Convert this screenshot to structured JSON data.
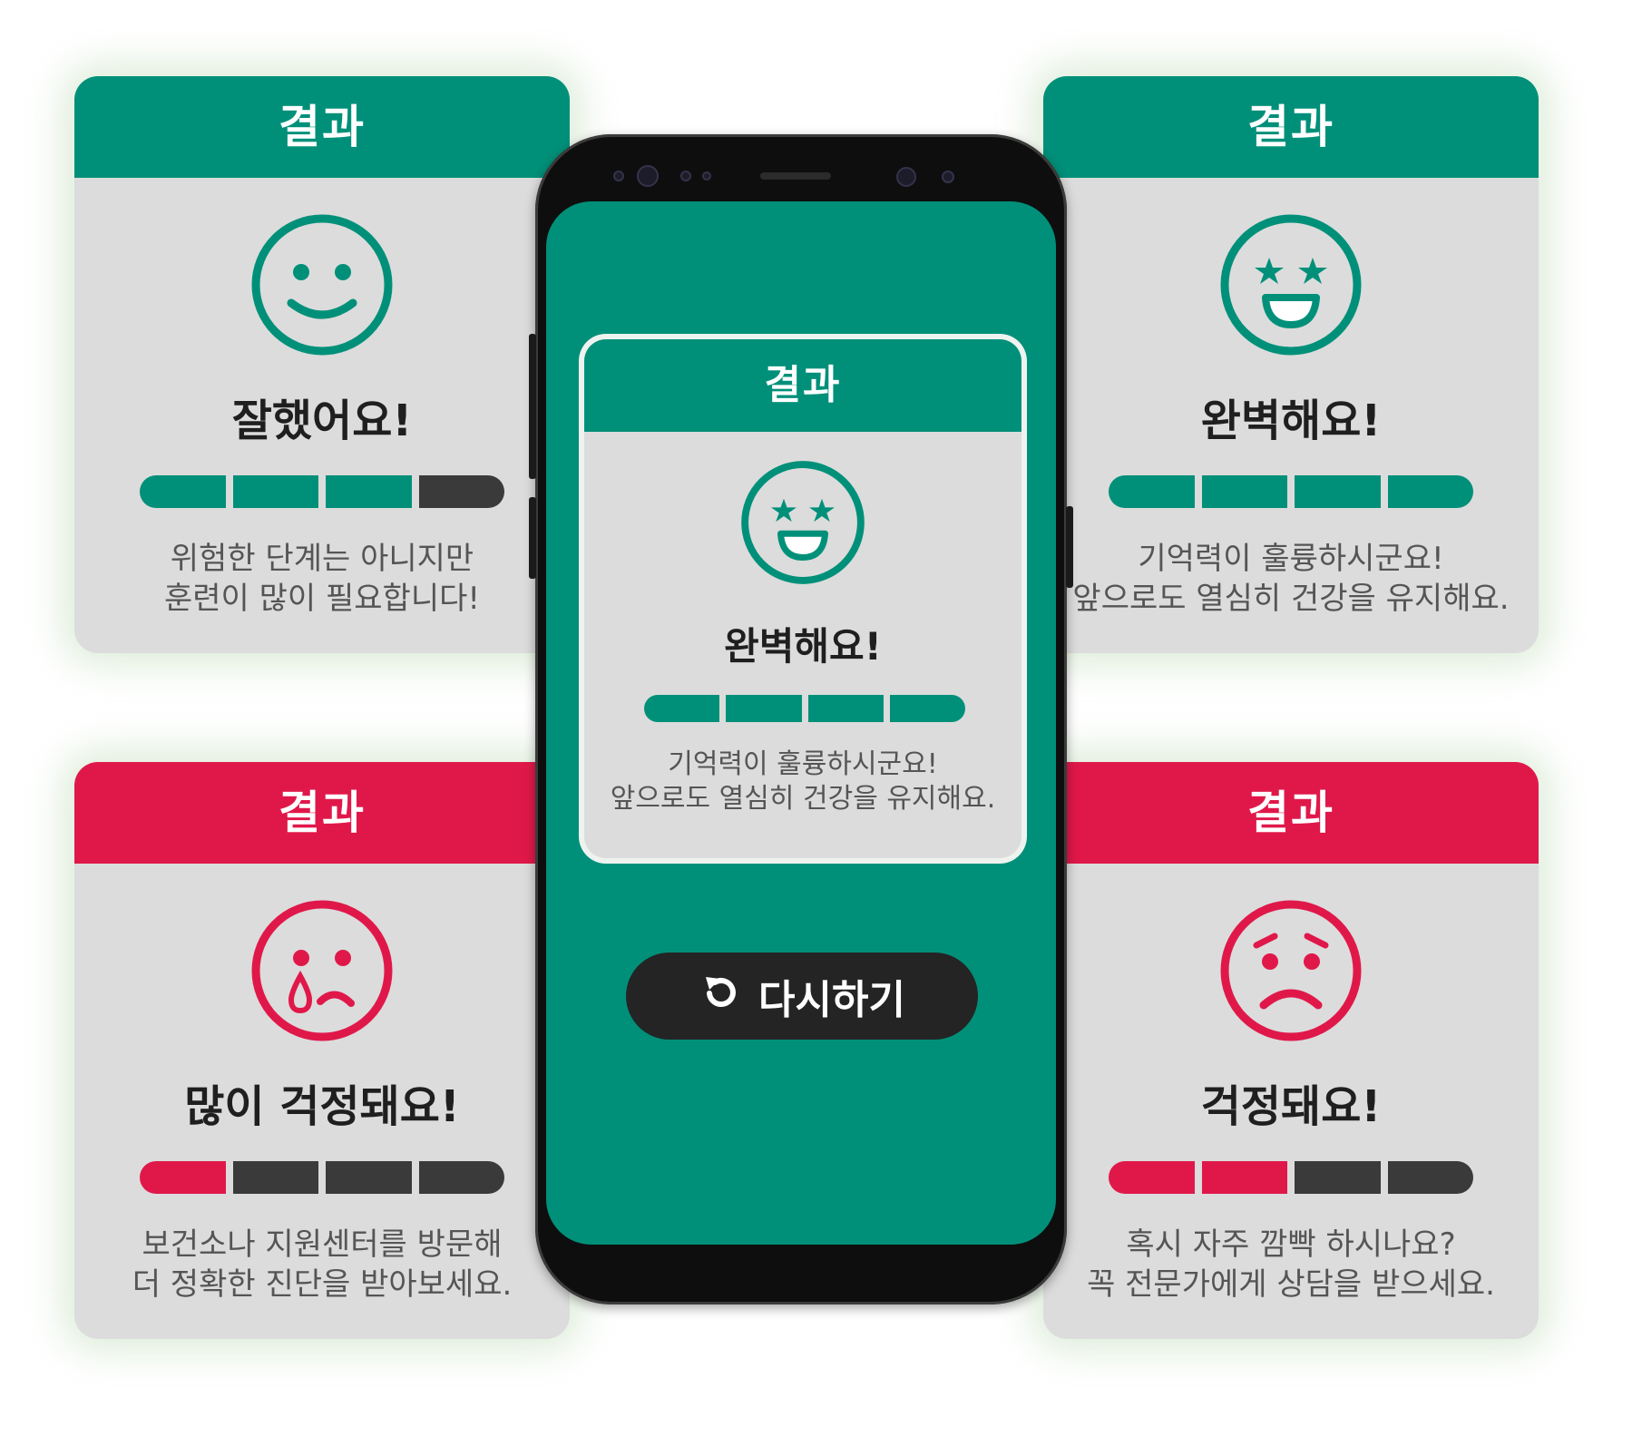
{
  "colors": {
    "green": "#009079",
    "red": "#e0184a",
    "dark": "#3a3a3a",
    "card_bg": "#dcdcdc",
    "button_bg": "#242424"
  },
  "cards": {
    "top_left": {
      "header": "결과",
      "face_icon": "smile-face-icon",
      "title": "잘했어요!",
      "level": 3,
      "total": 4,
      "message_line1": "위험한 단계는 아니지만",
      "message_line2": "훈련이 많이 필요합니다!"
    },
    "top_right": {
      "header": "결과",
      "face_icon": "star-eyes-face-icon",
      "title": "완벽해요!",
      "level": 4,
      "total": 4,
      "message_line1": "기억력이 훌륭하시군요!",
      "message_line2": "앞으로도 열심히 건강을 유지해요."
    },
    "bottom_left": {
      "header": "결과",
      "face_icon": "crying-face-icon",
      "title": "많이 걱정돼요!",
      "level": 1,
      "total": 4,
      "message_line1": "보건소나 지원센터를 방문해",
      "message_line2": "더 정확한 진단을 받아보세요."
    },
    "bottom_right": {
      "header": "결과",
      "face_icon": "worried-face-icon",
      "title": "걱정돼요!",
      "level": 2,
      "total": 4,
      "message_line1": "혹시 자주 깜빡 하시나요?",
      "message_line2": "꼭 전문가에게 상담을 받으세요."
    }
  },
  "phone": {
    "result": {
      "header": "결과",
      "face_icon": "star-eyes-face-icon",
      "title": "완벽해요!",
      "level": 4,
      "total": 4,
      "message_line1": "기억력이 훌륭하시군요!",
      "message_line2": "앞으로도 열심히 건강을 유지해요."
    },
    "retry_button": {
      "icon": "refresh-icon",
      "label": "다시하기"
    }
  }
}
